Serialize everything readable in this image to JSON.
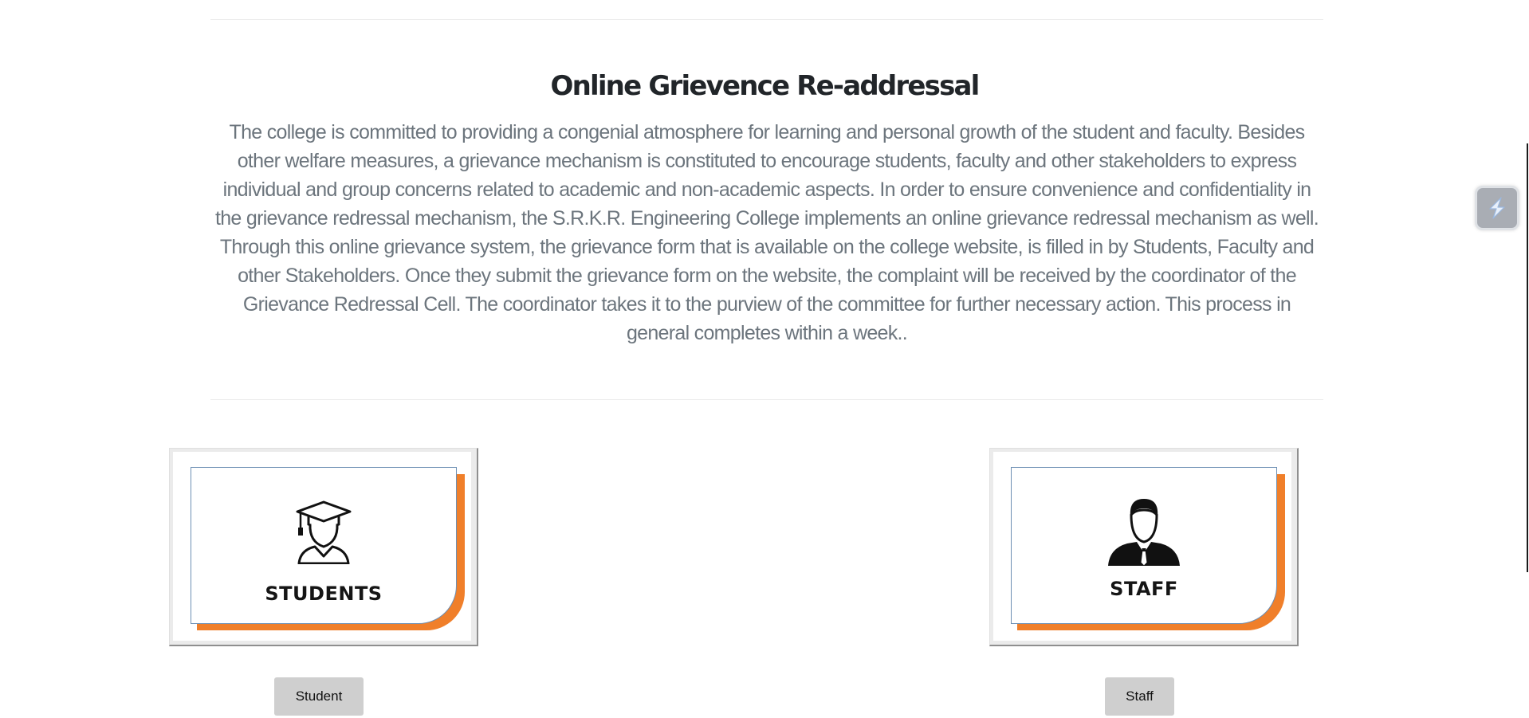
{
  "header": {
    "title": "Online Grievence Re-addressal"
  },
  "intro": {
    "text": "The college is committed to providing a congenial atmosphere for learning and personal growth of the student and faculty. Besides other welfare measures, a grievance mechanism is constituted to encourage students, faculty and other stakeholders to express individual and group concerns related to academic and non-academic aspects. In order to ensure convenience and confidentiality in the grievance redressal mechanism, the S.R.K.R. Engineering College implements an online grievance redressal mechanism as well. Through this online grievance system, the grievance form that is available on the college website, is filled in by Students, Faculty and other Stakeholders. Once they submit the grievance form on the website, the complaint will be received by the coordinator of the Grievance Redressal Cell. The coordinator takes it to the purview of the committee for further necessary action. This process in general completes within a week.."
  },
  "cards": {
    "student": {
      "label": "STUDENTS",
      "icon": "graduate-icon",
      "button_label": "Student"
    },
    "staff": {
      "label": "STAFF",
      "icon": "staff-person-icon",
      "button_label": "Staff"
    }
  },
  "widget": {
    "icon": "lightning-icon"
  },
  "colors": {
    "accent_orange": "#f07f2a",
    "card_border_blue": "#6d8fb3",
    "button_bg": "#cfcfcf",
    "title": "#212529",
    "body_text": "#6c757d"
  }
}
